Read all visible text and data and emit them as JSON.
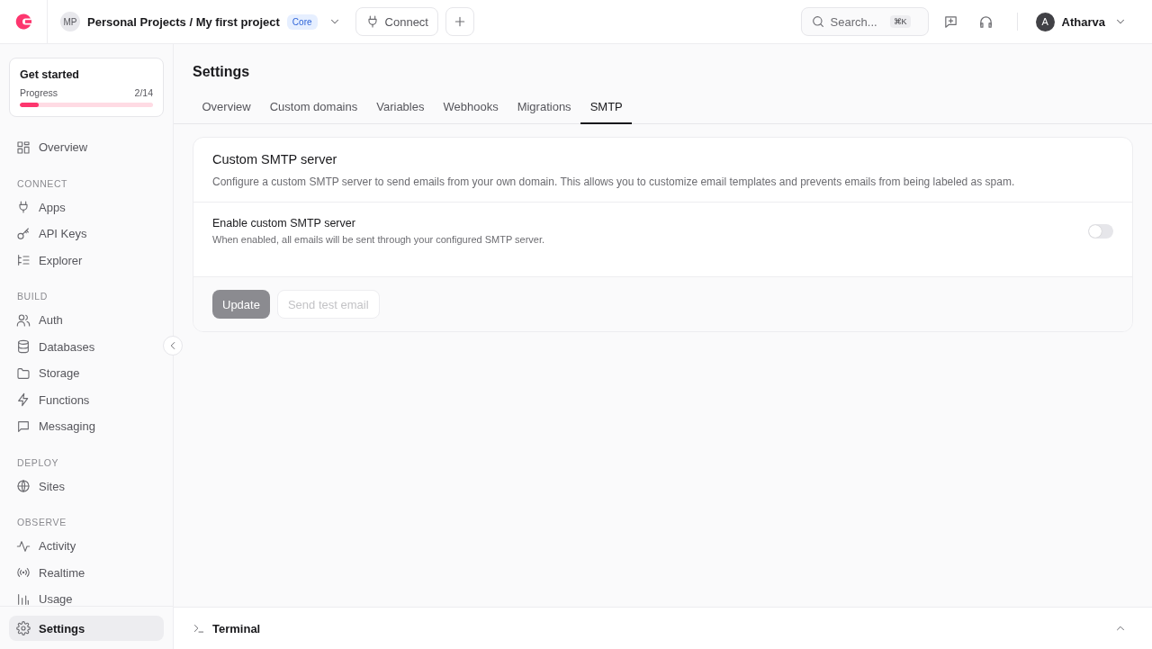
{
  "topbar": {
    "avatar_initials": "MP",
    "project": "Personal Projects / My first project",
    "plan_badge": "Core",
    "connect_button": "Connect",
    "search": {
      "placeholder": "Search...",
      "shortcut": "⌘K"
    },
    "user": {
      "initial": "A",
      "name": "Atharva"
    }
  },
  "sidebar": {
    "get_started": {
      "title": "Get started",
      "progress_label": "Progress",
      "count": "2/14",
      "level": 0.14
    },
    "sections": [
      {
        "items": [
          {
            "label": "Overview",
            "selected": false
          }
        ]
      },
      {
        "heading": "CONNECT",
        "items": [
          {
            "label": "Apps",
            "selected": false
          },
          {
            "label": "API Keys",
            "selected": false
          },
          {
            "label": "Explorer",
            "selected": false
          }
        ]
      },
      {
        "heading": "BUILD",
        "items": [
          {
            "label": "Auth",
            "selected": false
          },
          {
            "label": "Databases",
            "selected": false
          },
          {
            "label": "Storage",
            "selected": false
          },
          {
            "label": "Functions",
            "selected": false
          },
          {
            "label": "Messaging",
            "selected": false
          }
        ]
      },
      {
        "heading": "DEPLOY",
        "items": [
          {
            "label": "Sites",
            "selected": false
          }
        ]
      },
      {
        "heading": "OBSERVE",
        "items": [
          {
            "label": "Activity",
            "selected": false
          },
          {
            "label": "Realtime",
            "selected": false
          },
          {
            "label": "Usage",
            "selected": false
          }
        ]
      }
    ],
    "footer_item": {
      "label": "Settings",
      "selected": true
    }
  },
  "page": {
    "title": "Settings",
    "tabs": [
      {
        "label": "Overview",
        "selected": false
      },
      {
        "label": "Custom domains",
        "selected": false
      },
      {
        "label": "Variables",
        "selected": false
      },
      {
        "label": "Webhooks",
        "selected": false
      },
      {
        "label": "Migrations",
        "selected": false
      },
      {
        "label": "SMTP",
        "selected": true
      }
    ],
    "card": {
      "title": "Custom SMTP server",
      "description": "Configure a custom SMTP server to send emails from your own domain. This allows you to customize email templates and prevents emails from being labeled as spam.",
      "toggle": {
        "label": "Enable custom SMTP server",
        "hint": "When enabled, all emails will be sent through your configured SMTP server.",
        "on": false
      },
      "buttons": [
        {
          "label": "Update",
          "kind": "primary",
          "disabled": true
        },
        {
          "label": "Send test email",
          "kind": "secondary",
          "disabled": true
        }
      ]
    }
  },
  "terminal": {
    "label": "Terminal",
    "expanded": false
  }
}
